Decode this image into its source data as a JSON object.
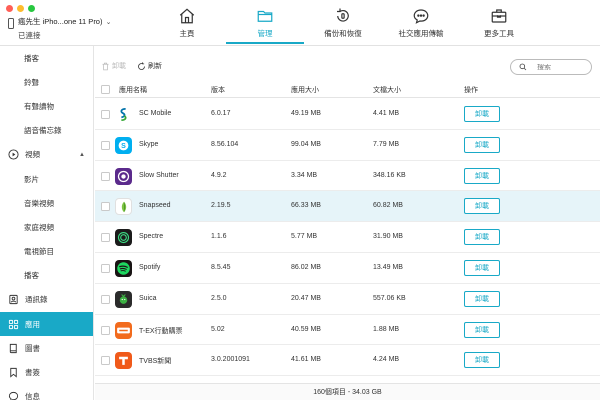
{
  "device": {
    "name": "瘋先生 iPho...one 11 Pro)",
    "status": "已連接"
  },
  "nav": [
    {
      "label": "主頁",
      "icon": "home-icon"
    },
    {
      "label": "管理",
      "icon": "folder-icon",
      "active": true
    },
    {
      "label": "備份和恢復",
      "icon": "backup-restore-icon"
    },
    {
      "label": "社交應用傳輸",
      "icon": "chat-bubble-icon"
    },
    {
      "label": "更多工具",
      "icon": "toolbox-icon"
    }
  ],
  "sidebar": {
    "items": [
      {
        "label": "播客"
      },
      {
        "label": "鈴聲"
      },
      {
        "label": "有聲讀物"
      },
      {
        "label": "語音備忘錄"
      },
      {
        "label": "視頻",
        "icon": "play-circle-icon",
        "category": true,
        "expanded": true
      },
      {
        "label": "影片"
      },
      {
        "label": "音樂視頻"
      },
      {
        "label": "家庭視頻"
      },
      {
        "label": "電視節目"
      },
      {
        "label": "播客"
      },
      {
        "label": "通訊錄",
        "icon": "contacts-icon",
        "category": true
      },
      {
        "label": "應用",
        "icon": "apps-grid-icon",
        "category": true,
        "active": true
      },
      {
        "label": "圖書",
        "icon": "book-icon",
        "category": true
      },
      {
        "label": "書簽",
        "icon": "bookmark-icon",
        "category": true
      },
      {
        "label": "信息",
        "icon": "message-icon",
        "category": true
      }
    ]
  },
  "toolbar": {
    "uninstall_label": "卸載",
    "refresh_label": "刷新",
    "search_placeholder": "搜索"
  },
  "table": {
    "headers": {
      "name": "應用名稱",
      "version": "版本",
      "app_size": "應用大小",
      "doc_size": "文檔大小",
      "action": "操作"
    },
    "action_label": "卸載",
    "rows": [
      {
        "name": "SC Mobile",
        "version": "6.0.17",
        "app_size": "49.19 MB",
        "doc_size": "4.41 MB",
        "icon": "sc-mobile-icon",
        "color": "#ffffff"
      },
      {
        "name": "Skype",
        "version": "8.56.104",
        "app_size": "99.04 MB",
        "doc_size": "7.79 MB",
        "icon": "skype-icon",
        "color": "#00aff0"
      },
      {
        "name": "Slow Shutter",
        "version": "4.9.2",
        "app_size": "3.34 MB",
        "doc_size": "348.16 KB",
        "icon": "slow-shutter-icon",
        "color": "#5b2a8c"
      },
      {
        "name": "Snapseed",
        "version": "2.19.5",
        "app_size": "66.33 MB",
        "doc_size": "60.82 MB",
        "icon": "snapseed-icon",
        "color": "#ffffff",
        "highlighted": true
      },
      {
        "name": "Spectre",
        "version": "1.1.6",
        "app_size": "5.77 MB",
        "doc_size": "31.90 MB",
        "icon": "spectre-icon",
        "color": "#1b1b1b"
      },
      {
        "name": "Spotify",
        "version": "8.5.45",
        "app_size": "86.02 MB",
        "doc_size": "13.49 MB",
        "icon": "spotify-icon",
        "color": "#191414"
      },
      {
        "name": "Suica",
        "version": "2.5.0",
        "app_size": "20.47 MB",
        "doc_size": "557.06 KB",
        "icon": "suica-icon",
        "color": "#2b2b2b"
      },
      {
        "name": "T-EX行動購票",
        "version": "5.02",
        "app_size": "40.59 MB",
        "doc_size": "1.88 MB",
        "icon": "tex-ticket-icon",
        "color": "#f26b1d"
      },
      {
        "name": "TVBS新聞",
        "version": "3.0.2001091",
        "app_size": "41.61 MB",
        "doc_size": "4.24 MB",
        "icon": "tvbs-news-icon",
        "color": "#f05a1a"
      }
    ]
  },
  "footer": {
    "summary": "160個項目 - 34.03 GB"
  },
  "colors": {
    "accent": "#19a9c7",
    "highlight_row": "#e6f4f9"
  }
}
